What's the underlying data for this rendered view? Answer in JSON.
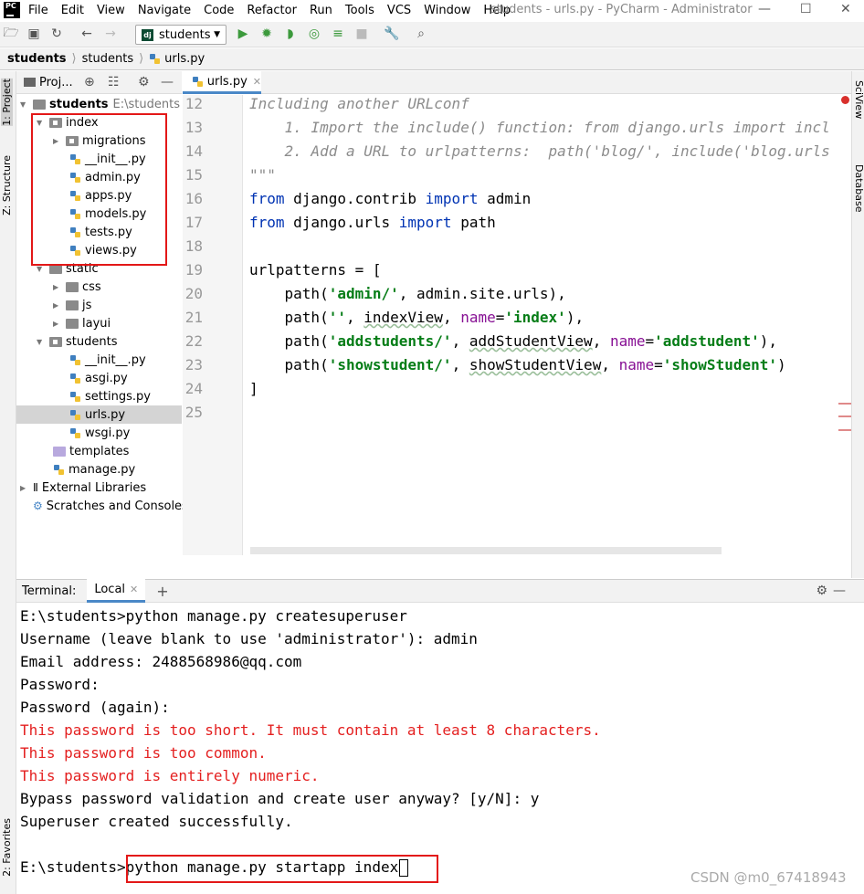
{
  "app": {
    "logo": "PC",
    "title": "students - urls.py - PyCharm - Administrator",
    "menu": [
      "File",
      "Edit",
      "View",
      "Navigate",
      "Code",
      "Refactor",
      "Run",
      "Tools",
      "VCS",
      "Window",
      "Help"
    ]
  },
  "toolbar": {
    "run_config": "students",
    "run_config_badge": "dj"
  },
  "breadcrumb": [
    "students",
    "students",
    "urls.py"
  ],
  "left_strip": {
    "project_tab": "1: Project",
    "structure_tab": "Z: Structure",
    "favorites_tab": "2: Favorites"
  },
  "right_strip": {
    "sciview_tab": "SciView",
    "database_tab": "Database"
  },
  "project_panel": {
    "tab_label": "Proj...",
    "root_name": "students",
    "root_path": "E:\\students",
    "items": [
      {
        "label": "index",
        "kind": "package",
        "expanded": true
      },
      {
        "label": "migrations",
        "kind": "package",
        "expanded": false
      },
      {
        "label": "__init__.py",
        "kind": "python"
      },
      {
        "label": "admin.py",
        "kind": "python"
      },
      {
        "label": "apps.py",
        "kind": "python"
      },
      {
        "label": "models.py",
        "kind": "python"
      },
      {
        "label": "tests.py",
        "kind": "python"
      },
      {
        "label": "views.py",
        "kind": "python"
      },
      {
        "label": "static",
        "kind": "folder",
        "expanded": true
      },
      {
        "label": "css",
        "kind": "folder",
        "expanded": false
      },
      {
        "label": "js",
        "kind": "folder",
        "expanded": false
      },
      {
        "label": "layui",
        "kind": "folder",
        "expanded": false
      },
      {
        "label": "students",
        "kind": "package",
        "expanded": true
      },
      {
        "label": "__init__.py",
        "kind": "python"
      },
      {
        "label": "asgi.py",
        "kind": "python"
      },
      {
        "label": "settings.py",
        "kind": "python"
      },
      {
        "label": "urls.py",
        "kind": "python",
        "selected": true
      },
      {
        "label": "wsgi.py",
        "kind": "python"
      },
      {
        "label": "templates",
        "kind": "template-folder"
      },
      {
        "label": "manage.py",
        "kind": "python"
      },
      {
        "label": "External Libraries",
        "kind": "library"
      },
      {
        "label": "Scratches and Consoles",
        "kind": "scratch"
      }
    ]
  },
  "editor": {
    "tab_label": "urls.py",
    "line_numbers": [
      "12",
      "13",
      "14",
      "15",
      "16",
      "17",
      "18",
      "19",
      "20",
      "21",
      "22",
      "23",
      "24",
      "25"
    ],
    "lines": {
      "l12": "Including another URLconf",
      "l13": "    1. Import the include() function: from django.urls import incl",
      "l14": "    2. Add a URL to urlpatterns:  path('blog/', include('blog.urls",
      "l15": "\"\"\"",
      "l16_kw1": "from",
      "l16_mod": " django.contrib ",
      "l16_kw2": "import",
      "l16_name": " admin",
      "l17_kw1": "from",
      "l17_mod": " django.urls ",
      "l17_kw2": "import",
      "l17_name": " path",
      "l19": "urlpatterns = [",
      "l20_a": "    path(",
      "l20_s": "'admin/'",
      "l20_b": ", admin.site.urls),",
      "l21_a": "    path(",
      "l21_s1": "''",
      "l21_b": ", ",
      "l21_v": "indexView",
      "l21_c": ", ",
      "l21_n": "name",
      "l21_d": "=",
      "l21_s2": "'index'",
      "l21_e": "),",
      "l22_a": "    path(",
      "l22_s1": "'addstudents/'",
      "l22_b": ", ",
      "l22_v": "addStudentView",
      "l22_c": ", ",
      "l22_n": "name",
      "l22_d": "=",
      "l22_s2": "'addstudent'",
      "l22_e": "),",
      "l23_a": "    path(",
      "l23_s1": "'showstudent/'",
      "l23_b": ", ",
      "l23_v": "showStudentView",
      "l23_c": ", ",
      "l23_n": "name",
      "l23_d": "=",
      "l23_s2": "'showStudent'",
      "l23_e": ")",
      "l24": "]"
    }
  },
  "terminal": {
    "header_label": "Terminal:",
    "tab_label": "Local",
    "lines": [
      {
        "text": "E:\\students>python manage.py createsuperuser",
        "error": false
      },
      {
        "text": "Username (leave blank to use 'administrator'): admin",
        "error": false
      },
      {
        "text": "Email address: 2488568986@qq.com",
        "error": false
      },
      {
        "text": "Password:",
        "error": false
      },
      {
        "text": "Password (again):",
        "error": false
      },
      {
        "text": "This password is too short. It must contain at least 8 characters.",
        "error": true
      },
      {
        "text": "This password is too common.",
        "error": true
      },
      {
        "text": "This password is entirely numeric.",
        "error": true
      },
      {
        "text": "Bypass password validation and create user anyway? [y/N]: y",
        "error": false
      },
      {
        "text": "Superuser created successfully.",
        "error": false
      }
    ],
    "prompt": "E:\\students>",
    "current_command": "python manage.py startapp index"
  },
  "watermark": "CSDN @m0_67418943",
  "colors": {
    "highlight_box": "#e31818",
    "error_text": "#e42020",
    "keyword": "#0033b3",
    "string": "#067d17"
  }
}
